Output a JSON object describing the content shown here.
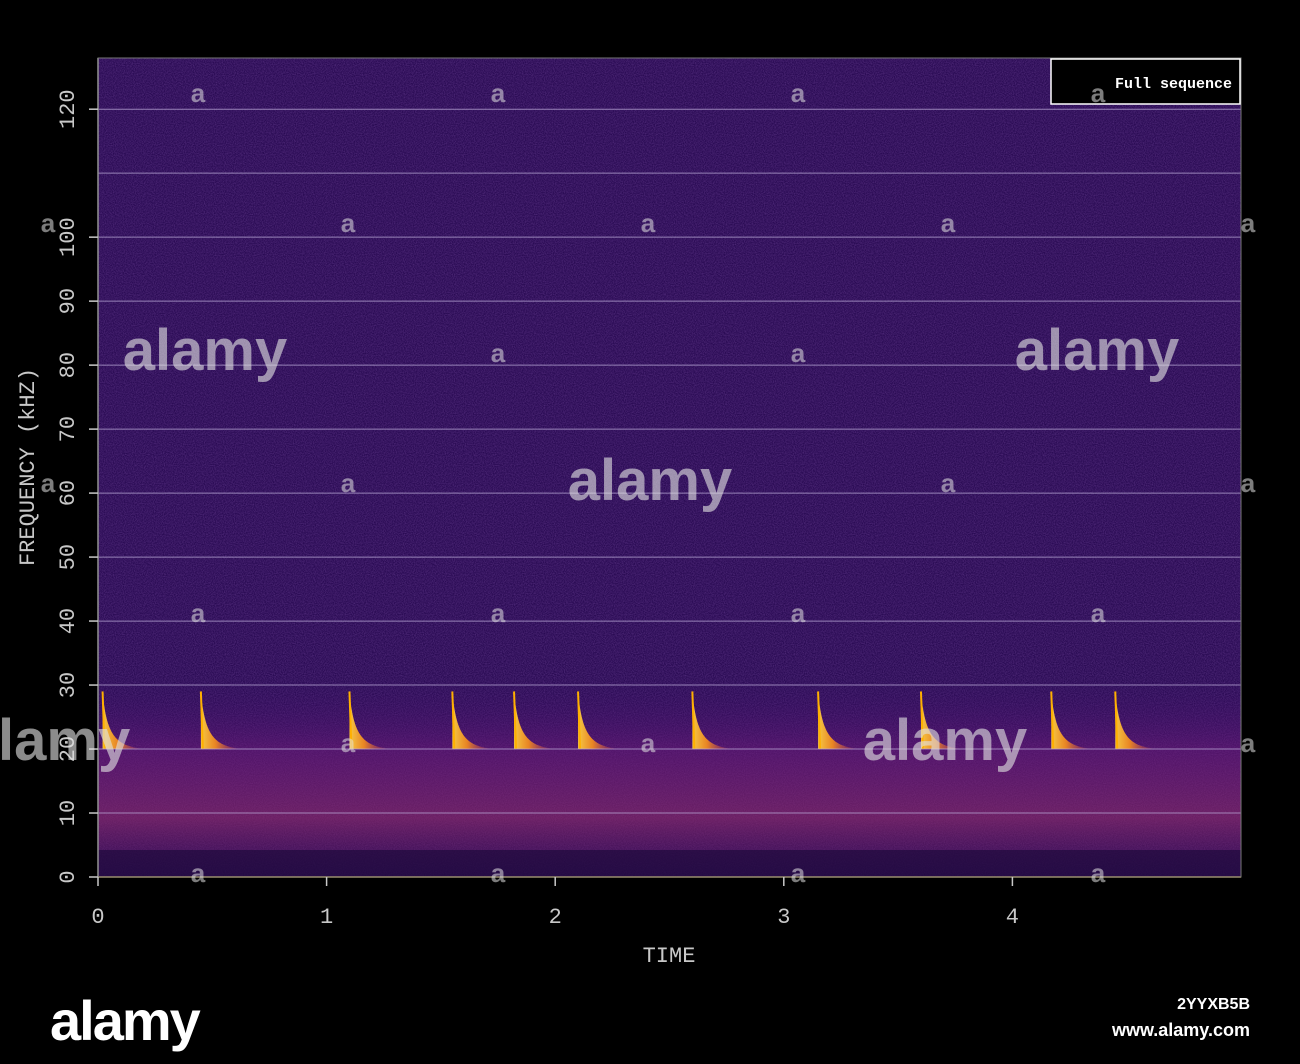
{
  "chart_data": {
    "type": "heatmap",
    "title": "",
    "xlabel": "TIME",
    "ylabel": "FREQUENCY (kHZ)",
    "xlim": [
      0,
      5
    ],
    "ylim": [
      0,
      128
    ],
    "x_ticks": [
      0,
      1,
      2,
      3,
      4
    ],
    "y_ticks": [
      0,
      10,
      20,
      30,
      40,
      50,
      60,
      70,
      80,
      90,
      100,
      120
    ],
    "y_gridlines": [
      10,
      20,
      30,
      40,
      50,
      60,
      70,
      80,
      90,
      100,
      110,
      120
    ],
    "grid": true,
    "colormap": "inferno",
    "legend": {
      "label": "Full sequence",
      "placement": "top-right"
    },
    "call_times": [
      0.02,
      0.45,
      1.1,
      1.55,
      1.82,
      2.1,
      2.6,
      3.15,
      3.6,
      4.17,
      4.45
    ],
    "call_band_khz": [
      20,
      30
    ],
    "background_noise_band_khz": [
      3,
      28
    ]
  },
  "watermark": {
    "brand": "alamy",
    "image_id": "2YYXB5B",
    "url": "www.alamy.com"
  },
  "colors": {
    "background": "#000000",
    "plot_bg": "#2a0b54",
    "grid": "#b9a8d6",
    "call_hot": "#ffb000",
    "axis_text": "#c8c8c8"
  }
}
